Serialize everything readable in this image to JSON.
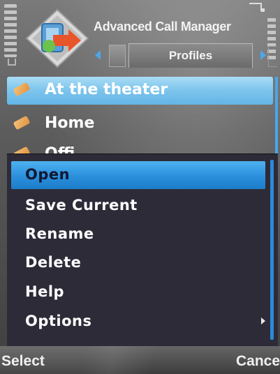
{
  "header": {
    "app_title": "Advanced Call Manager",
    "tab_label": "Profiles"
  },
  "list": {
    "items": [
      {
        "label": "At the theater",
        "icon": "ticket-icon",
        "selected": true
      },
      {
        "label": "Home",
        "icon": "ticket-icon",
        "selected": false
      },
      {
        "label": "Offi",
        "icon": "ticket-icon",
        "selected": false
      }
    ]
  },
  "menu": {
    "items": [
      {
        "label": "Open",
        "highlighted": true
      },
      {
        "label": "Save Current",
        "highlighted": false
      },
      {
        "label": "Rename",
        "highlighted": false
      },
      {
        "label": "Delete",
        "highlighted": false
      },
      {
        "label": "Help",
        "highlighted": false
      },
      {
        "label": "Options",
        "highlighted": false,
        "submenu": true
      }
    ]
  },
  "softkeys": {
    "left": "Select",
    "right": "Cance"
  },
  "colors": {
    "accent": "#4aa7e8",
    "menu_highlight": "#2a8fdc",
    "list_selection": "#7cc4ec",
    "menu_background": "#2e2b38"
  }
}
